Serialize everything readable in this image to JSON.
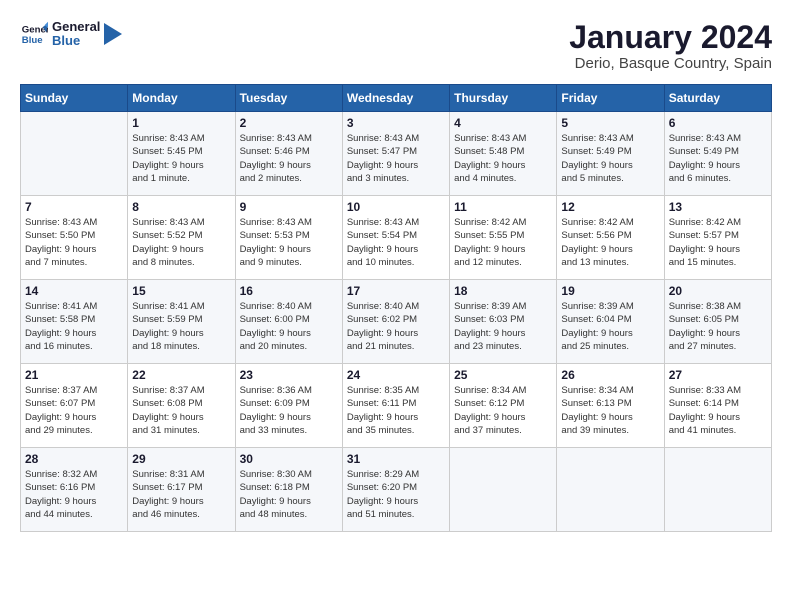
{
  "logo": {
    "line1": "General",
    "line2": "Blue"
  },
  "title": "January 2024",
  "subtitle": "Derio, Basque Country, Spain",
  "header_days": [
    "Sunday",
    "Monday",
    "Tuesday",
    "Wednesday",
    "Thursday",
    "Friday",
    "Saturday"
  ],
  "weeks": [
    [
      {
        "day": "",
        "info": ""
      },
      {
        "day": "1",
        "info": "Sunrise: 8:43 AM\nSunset: 5:45 PM\nDaylight: 9 hours\nand 1 minute."
      },
      {
        "day": "2",
        "info": "Sunrise: 8:43 AM\nSunset: 5:46 PM\nDaylight: 9 hours\nand 2 minutes."
      },
      {
        "day": "3",
        "info": "Sunrise: 8:43 AM\nSunset: 5:47 PM\nDaylight: 9 hours\nand 3 minutes."
      },
      {
        "day": "4",
        "info": "Sunrise: 8:43 AM\nSunset: 5:48 PM\nDaylight: 9 hours\nand 4 minutes."
      },
      {
        "day": "5",
        "info": "Sunrise: 8:43 AM\nSunset: 5:49 PM\nDaylight: 9 hours\nand 5 minutes."
      },
      {
        "day": "6",
        "info": "Sunrise: 8:43 AM\nSunset: 5:49 PM\nDaylight: 9 hours\nand 6 minutes."
      }
    ],
    [
      {
        "day": "7",
        "info": "Sunrise: 8:43 AM\nSunset: 5:50 PM\nDaylight: 9 hours\nand 7 minutes."
      },
      {
        "day": "8",
        "info": "Sunrise: 8:43 AM\nSunset: 5:52 PM\nDaylight: 9 hours\nand 8 minutes."
      },
      {
        "day": "9",
        "info": "Sunrise: 8:43 AM\nSunset: 5:53 PM\nDaylight: 9 hours\nand 9 minutes."
      },
      {
        "day": "10",
        "info": "Sunrise: 8:43 AM\nSunset: 5:54 PM\nDaylight: 9 hours\nand 10 minutes."
      },
      {
        "day": "11",
        "info": "Sunrise: 8:42 AM\nSunset: 5:55 PM\nDaylight: 9 hours\nand 12 minutes."
      },
      {
        "day": "12",
        "info": "Sunrise: 8:42 AM\nSunset: 5:56 PM\nDaylight: 9 hours\nand 13 minutes."
      },
      {
        "day": "13",
        "info": "Sunrise: 8:42 AM\nSunset: 5:57 PM\nDaylight: 9 hours\nand 15 minutes."
      }
    ],
    [
      {
        "day": "14",
        "info": "Sunrise: 8:41 AM\nSunset: 5:58 PM\nDaylight: 9 hours\nand 16 minutes."
      },
      {
        "day": "15",
        "info": "Sunrise: 8:41 AM\nSunset: 5:59 PM\nDaylight: 9 hours\nand 18 minutes."
      },
      {
        "day": "16",
        "info": "Sunrise: 8:40 AM\nSunset: 6:00 PM\nDaylight: 9 hours\nand 20 minutes."
      },
      {
        "day": "17",
        "info": "Sunrise: 8:40 AM\nSunset: 6:02 PM\nDaylight: 9 hours\nand 21 minutes."
      },
      {
        "day": "18",
        "info": "Sunrise: 8:39 AM\nSunset: 6:03 PM\nDaylight: 9 hours\nand 23 minutes."
      },
      {
        "day": "19",
        "info": "Sunrise: 8:39 AM\nSunset: 6:04 PM\nDaylight: 9 hours\nand 25 minutes."
      },
      {
        "day": "20",
        "info": "Sunrise: 8:38 AM\nSunset: 6:05 PM\nDaylight: 9 hours\nand 27 minutes."
      }
    ],
    [
      {
        "day": "21",
        "info": "Sunrise: 8:37 AM\nSunset: 6:07 PM\nDaylight: 9 hours\nand 29 minutes."
      },
      {
        "day": "22",
        "info": "Sunrise: 8:37 AM\nSunset: 6:08 PM\nDaylight: 9 hours\nand 31 minutes."
      },
      {
        "day": "23",
        "info": "Sunrise: 8:36 AM\nSunset: 6:09 PM\nDaylight: 9 hours\nand 33 minutes."
      },
      {
        "day": "24",
        "info": "Sunrise: 8:35 AM\nSunset: 6:11 PM\nDaylight: 9 hours\nand 35 minutes."
      },
      {
        "day": "25",
        "info": "Sunrise: 8:34 AM\nSunset: 6:12 PM\nDaylight: 9 hours\nand 37 minutes."
      },
      {
        "day": "26",
        "info": "Sunrise: 8:34 AM\nSunset: 6:13 PM\nDaylight: 9 hours\nand 39 minutes."
      },
      {
        "day": "27",
        "info": "Sunrise: 8:33 AM\nSunset: 6:14 PM\nDaylight: 9 hours\nand 41 minutes."
      }
    ],
    [
      {
        "day": "28",
        "info": "Sunrise: 8:32 AM\nSunset: 6:16 PM\nDaylight: 9 hours\nand 44 minutes."
      },
      {
        "day": "29",
        "info": "Sunrise: 8:31 AM\nSunset: 6:17 PM\nDaylight: 9 hours\nand 46 minutes."
      },
      {
        "day": "30",
        "info": "Sunrise: 8:30 AM\nSunset: 6:18 PM\nDaylight: 9 hours\nand 48 minutes."
      },
      {
        "day": "31",
        "info": "Sunrise: 8:29 AM\nSunset: 6:20 PM\nDaylight: 9 hours\nand 51 minutes."
      },
      {
        "day": "",
        "info": ""
      },
      {
        "day": "",
        "info": ""
      },
      {
        "day": "",
        "info": ""
      }
    ]
  ]
}
